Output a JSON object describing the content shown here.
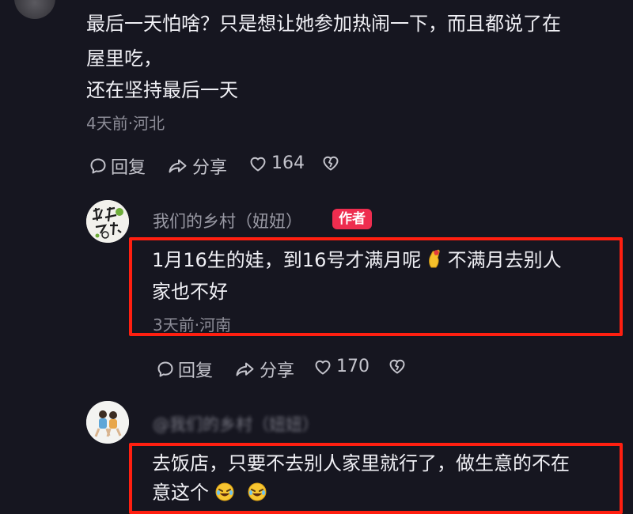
{
  "comment1": {
    "text_line1": "最后一天怕啥？只是想让她参加热闹一下，而且都说了在",
    "text_line2": "屋里吃，",
    "text_line3": "还在坚持最后一天",
    "meta": "4天前·河北",
    "actions": {
      "reply": "回复",
      "share": "分享",
      "likes": "164"
    }
  },
  "reply1": {
    "username": "我们的乡村（妞妞）",
    "badge": "作者",
    "text_line1_a": "1月16生的娃，到16号才满月呢",
    "text_line1_b": "不满月去别人",
    "text_line2": "家也不好",
    "meta": "3天前·河南",
    "actions": {
      "reply": "回复",
      "share": "分享",
      "likes": "170"
    }
  },
  "reply2": {
    "username_blurred": "@我们的乡村（妞妞）",
    "text_line1": "去饭店，只要不去别人家里就行了，做生意的不在",
    "text_line2": "意这个"
  },
  "colors": {
    "background": "#161620",
    "highlight_box": "#ff1f10",
    "author_badge": "#ee2d4f",
    "meta_text": "#8d8d98"
  },
  "icons": {
    "reply": "speech-bubble-icon",
    "share": "share-arrow-icon",
    "like": "heart-outline-icon",
    "dislike": "broken-heart-icon",
    "hand_emoji": "pinched-hand-emoji",
    "laugh_emoji": "rolling-laughing-emoji"
  }
}
